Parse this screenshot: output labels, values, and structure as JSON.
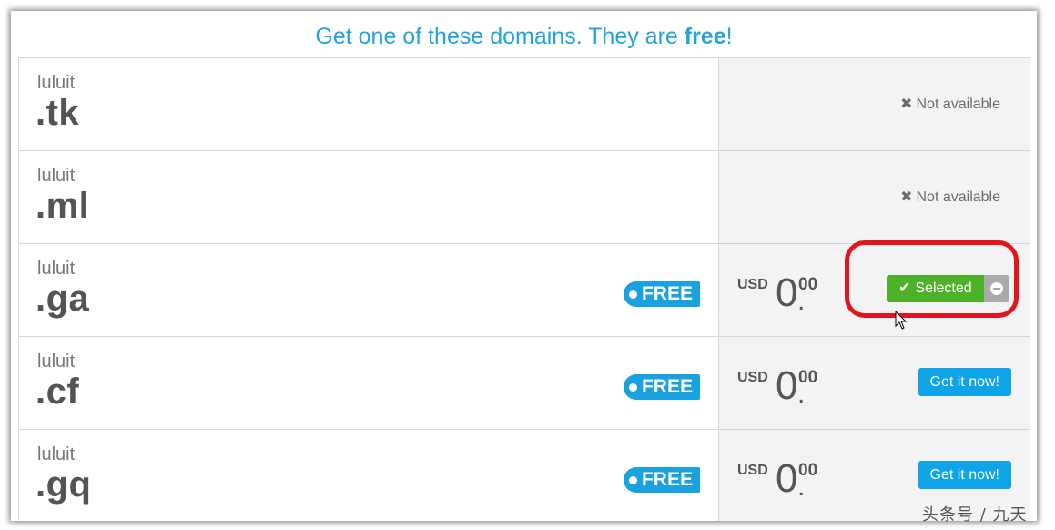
{
  "header": {
    "headline_prefix": "Get one of these domains. They are ",
    "headline_bold": "free",
    "headline_suffix": "!"
  },
  "domains": [
    {
      "sld": "luluit",
      "tld": ".tk",
      "status": "Not available"
    },
    {
      "sld": "luluit",
      "tld": ".ml",
      "status": "Not available"
    },
    {
      "sld": "luluit",
      "tld": ".ga",
      "badge": "FREE",
      "currency": "USD",
      "price_int": "0",
      "price_dec": "00",
      "button": "Selected"
    },
    {
      "sld": "luluit",
      "tld": ".cf",
      "badge": "FREE",
      "currency": "USD",
      "price_int": "0",
      "price_dec": "00",
      "button": "Get it now!"
    },
    {
      "sld": "luluit",
      "tld": ".gq",
      "badge": "FREE",
      "currency": "USD",
      "price_int": "0",
      "price_dec": "00",
      "button": "Get it now!"
    }
  ],
  "icons": {
    "not_available": "close-icon",
    "selected": "check-icon",
    "remove": "minus-circle-icon",
    "badge": "dot-icon"
  },
  "colors": {
    "headline": "#21a3dc",
    "free_badge": "#1aa1e0",
    "get_button": "#0fa3e8",
    "selected_button": "#4db22a",
    "highlight": "#e3141c"
  },
  "watermark": "头条号 / 九天"
}
